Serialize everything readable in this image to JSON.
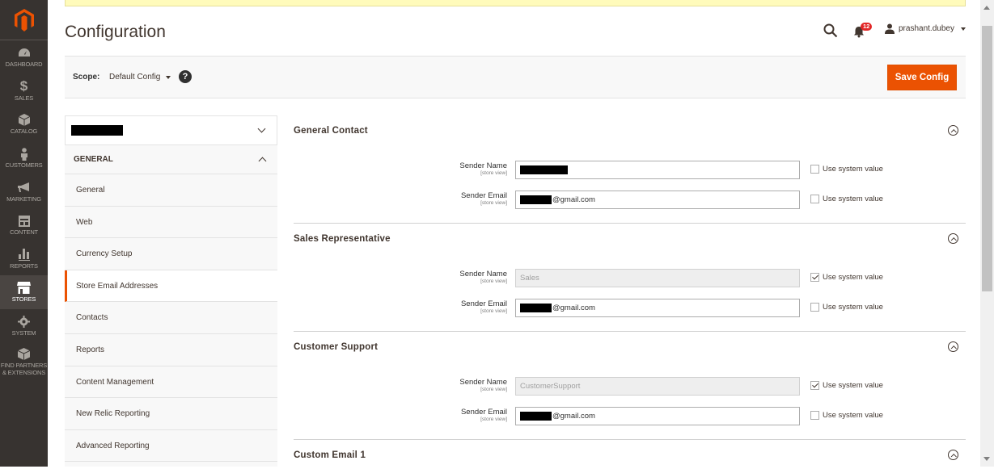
{
  "menu": {
    "items": [
      {
        "id": "dashboard",
        "label": "DASHBOARD",
        "icon": "dashboard-icon"
      },
      {
        "id": "sales",
        "label": "SALES",
        "icon": "dollar-icon"
      },
      {
        "id": "catalog",
        "label": "CATALOG",
        "icon": "cube-icon"
      },
      {
        "id": "customers",
        "label": "CUSTOMERS",
        "icon": "person-icon"
      },
      {
        "id": "marketing",
        "label": "MARKETING",
        "icon": "megaphone-icon"
      },
      {
        "id": "content",
        "label": "CONTENT",
        "icon": "layout-icon"
      },
      {
        "id": "reports",
        "label": "REPORTS",
        "icon": "bar-chart-icon"
      },
      {
        "id": "stores",
        "label": "STORES",
        "icon": "store-icon",
        "active": true
      },
      {
        "id": "system",
        "label": "SYSTEM",
        "icon": "gear-icon"
      },
      {
        "id": "partners",
        "label": "FIND PARTNERS & EXTENSIONS",
        "icon": "box-icon"
      }
    ]
  },
  "header": {
    "title": "Configuration",
    "notifications_count": "12",
    "username": "prashant.dubey"
  },
  "scope": {
    "label": "Scope:",
    "value": "Default Config",
    "help": "?",
    "save_label": "Save Config"
  },
  "nav": {
    "section": "GENERAL",
    "items": [
      {
        "label": "General"
      },
      {
        "label": "Web"
      },
      {
        "label": "Currency Setup"
      },
      {
        "label": "Store Email Addresses",
        "active": true
      },
      {
        "label": "Contacts"
      },
      {
        "label": "Reports"
      },
      {
        "label": "Content Management"
      },
      {
        "label": "New Relic Reporting"
      },
      {
        "label": "Advanced Reporting"
      }
    ]
  },
  "groups": {
    "general_contact": {
      "title": "General Contact",
      "sender_name_label": "Sender Name",
      "sender_email_label": "Sender Email",
      "scope_note": "[store view]",
      "sender_email_suffix": "@gmail.com",
      "use_system": "Use system value"
    },
    "sales_rep": {
      "title": "Sales Representative",
      "sender_name_label": "Sender Name",
      "sender_name_value": "Sales",
      "sender_email_label": "Sender Email",
      "scope_note": "[store view]",
      "sender_email_suffix": "@gmail.com",
      "use_system": "Use system value"
    },
    "customer_support": {
      "title": "Customer Support",
      "sender_name_label": "Sender Name",
      "sender_name_value": "CustomerSupport",
      "sender_email_label": "Sender Email",
      "scope_note": "[store view]",
      "sender_email_suffix": "@gmail.com",
      "use_system": "Use system value"
    },
    "custom_email_1": {
      "title": "Custom Email 1"
    }
  },
  "colors": {
    "menu_bg": "#373330",
    "accent": "#eb5202",
    "notice": "#fffbbb"
  }
}
